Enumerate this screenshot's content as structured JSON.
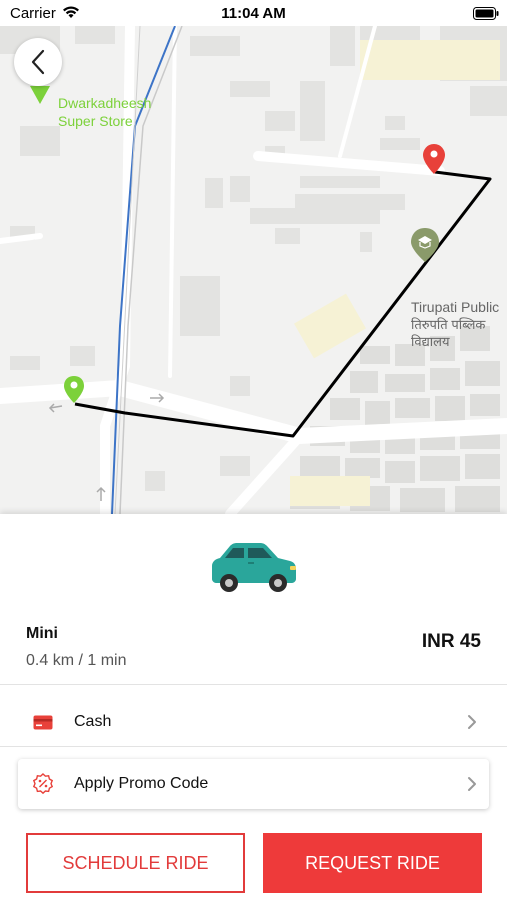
{
  "status_bar": {
    "carrier": "Carrier",
    "time": "11:04 AM"
  },
  "map": {
    "store_label_line1": "Dwarkadheesh",
    "store_label_line2": "Super Store",
    "school_label_line1": "Tirupati Public",
    "school_label_line2": "तिरुपति पब्लिक",
    "school_label_line3": "विद्यालय",
    "colors": {
      "route": "#000000",
      "destination_pin": "#e8413a",
      "origin_pin": "#7cd13a",
      "rail": "#3d74c7"
    }
  },
  "ride": {
    "name": "Mini",
    "meta": "0.4 km / 1 min",
    "price": "INR 45",
    "car_color": "#2aa69b"
  },
  "payment": {
    "label": "Cash",
    "icon": "card-icon"
  },
  "promo": {
    "label": "Apply Promo Code",
    "icon": "discount-badge-icon"
  },
  "buttons": {
    "schedule": "SCHEDULE RIDE",
    "request": "REQUEST RIDE"
  },
  "colors": {
    "accent": "#ee3a3a"
  }
}
